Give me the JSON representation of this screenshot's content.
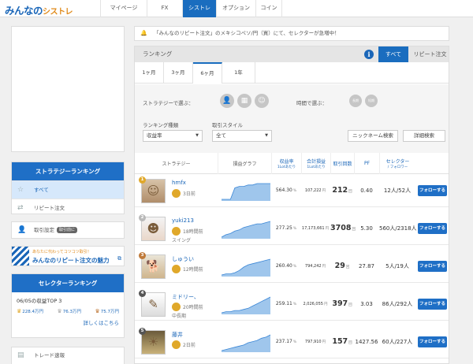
{
  "header": {
    "logo_part1": "みんなの",
    "logo_part2": "シストレ",
    "nav": [
      {
        "label": "マイページ",
        "active": false
      },
      {
        "label": "FX",
        "active": false
      },
      {
        "label": "シストレ",
        "active": true
      },
      {
        "label": "オプション",
        "active": false
      },
      {
        "label": "コイン",
        "active": false
      }
    ]
  },
  "sidebar": {
    "strategy_ranking_title": "ストラテジーランキング",
    "items": [
      {
        "label": "すべて",
        "icon": "star-icon",
        "selected": true
      },
      {
        "label": "リピート注文",
        "icon": "repeat-icon",
        "selected": false
      }
    ],
    "trade_settings_label": "取引設定",
    "trade_settings_badge": "取引前に",
    "banner_small": "あなたに代わってコツコツ取引！",
    "banner_big": "みんなのリピート注文の魅力",
    "selector_ranking_title": "セレクターランキング",
    "top3_title": "06/05の収益TOP 3",
    "top3_values": [
      "228.4万円",
      "76.3万円",
      "75.7万円"
    ],
    "details_link": "詳しくはこちら",
    "trade_summary_label": "トレード速報"
  },
  "notice": {
    "text": "「みんなのリピート注文」のメキシコペソ/円（買）にて、セレクターが急増中！"
  },
  "ranking": {
    "title": "ランキング",
    "tab_all": "すべて",
    "tab_repeat": "リピート注文",
    "periods": [
      {
        "label": "1ヶ月",
        "selected": false
      },
      {
        "label": "3ヶ月",
        "selected": false
      },
      {
        "label": "6ヶ月",
        "selected": true
      },
      {
        "label": "1年",
        "selected": false
      }
    ],
    "filter_strategist_label": "ストラテジーで選ぶ：",
    "filter_holding_label": "時間で選ぶ：",
    "holding_btn_1": "長期",
    "holding_btn_2": "短期",
    "ranking_type_label": "ランキング種類",
    "ranking_type_value": "収益率",
    "trade_style_label": "取引スタイル",
    "trade_style_value": "全て",
    "nickname_search": "ニックネーム検索",
    "detail_search": "詳細検索",
    "columns": {
      "strategy": "ストラテジー",
      "graph": "損益グラフ",
      "return_rate": "収益率",
      "return_rate_sub": "1Lotあたり",
      "total_pl": "合計損益",
      "total_pl_sub": "1Lotあたり",
      "trades": "取引回数",
      "pf": "PF",
      "selectors": "セレクター",
      "selectors_sub": "/ フォロワー"
    },
    "follow_label": "フォローする",
    "rows": [
      {
        "rank": "1",
        "rank_color": "#e0a82a",
        "name": "hmfx",
        "updated": "3日前",
        "style": "",
        "return_rate": "564.30",
        "return_unit": "%",
        "total_pl": "107,222",
        "pl_unit": "円",
        "trades": "212",
        "trades_unit": "回",
        "pf": "0.40",
        "selectors": "12人/52人",
        "spark": [
          1,
          1,
          1,
          9,
          10,
          10,
          11,
          11,
          12,
          12,
          12,
          12
        ]
      },
      {
        "rank": "2",
        "rank_color": "#b9b9b9",
        "name": "yuki213",
        "updated": "18時間前",
        "style": "スイング",
        "return_rate": "277.25",
        "return_unit": "%",
        "total_pl": "17,173,661",
        "pl_unit": "円",
        "trades": "3708",
        "trades_unit": "回",
        "pf": "5.30",
        "selectors": "560人/2318人",
        "spark": [
          1,
          3,
          4,
          6,
          7,
          9,
          10,
          11,
          12,
          12,
          13,
          14
        ]
      },
      {
        "rank": "3",
        "rank_color": "#c07a3a",
        "name": "しゅうい",
        "updated": "12時間前",
        "style": "",
        "return_rate": "260.40",
        "return_unit": "%",
        "total_pl": "794,242",
        "pl_unit": "円",
        "trades": "29",
        "trades_unit": "回",
        "pf": "27.87",
        "selectors": "5人/19人",
        "spark": [
          1,
          2,
          2,
          3,
          5,
          8,
          10,
          11,
          12,
          13,
          14,
          15
        ]
      },
      {
        "rank": "4",
        "rank_color": "#555555",
        "name": "ミドリー、",
        "updated": "20時間前",
        "style": "中長期",
        "return_rate": "259.11",
        "return_unit": "%",
        "total_pl": "2,026,055",
        "pl_unit": "円",
        "trades": "397",
        "trades_unit": "回",
        "pf": "3.03",
        "selectors": "86人/292人",
        "spark": [
          1,
          2,
          2,
          3,
          3,
          4,
          5,
          7,
          9,
          11,
          13,
          15
        ]
      },
      {
        "rank": "5",
        "rank_color": "#555555",
        "name": "藤井",
        "updated": "2日前",
        "style": "",
        "return_rate": "237.17",
        "return_unit": "%",
        "total_pl": "797,910",
        "pl_unit": "円",
        "trades": "157",
        "trades_unit": "回",
        "pf": "1427.56",
        "selectors": "60人/227人",
        "spark": [
          1,
          2,
          3,
          4,
          5,
          6,
          8,
          9,
          10,
          12,
          13,
          15
        ]
      }
    ]
  },
  "colors": {
    "brand": "#1a66b8",
    "accent_orange": "#e08a1a",
    "button_blue": "#1f6fc6",
    "spark_fill": "#9fc6ec",
    "spark_line": "#3a86d6"
  }
}
